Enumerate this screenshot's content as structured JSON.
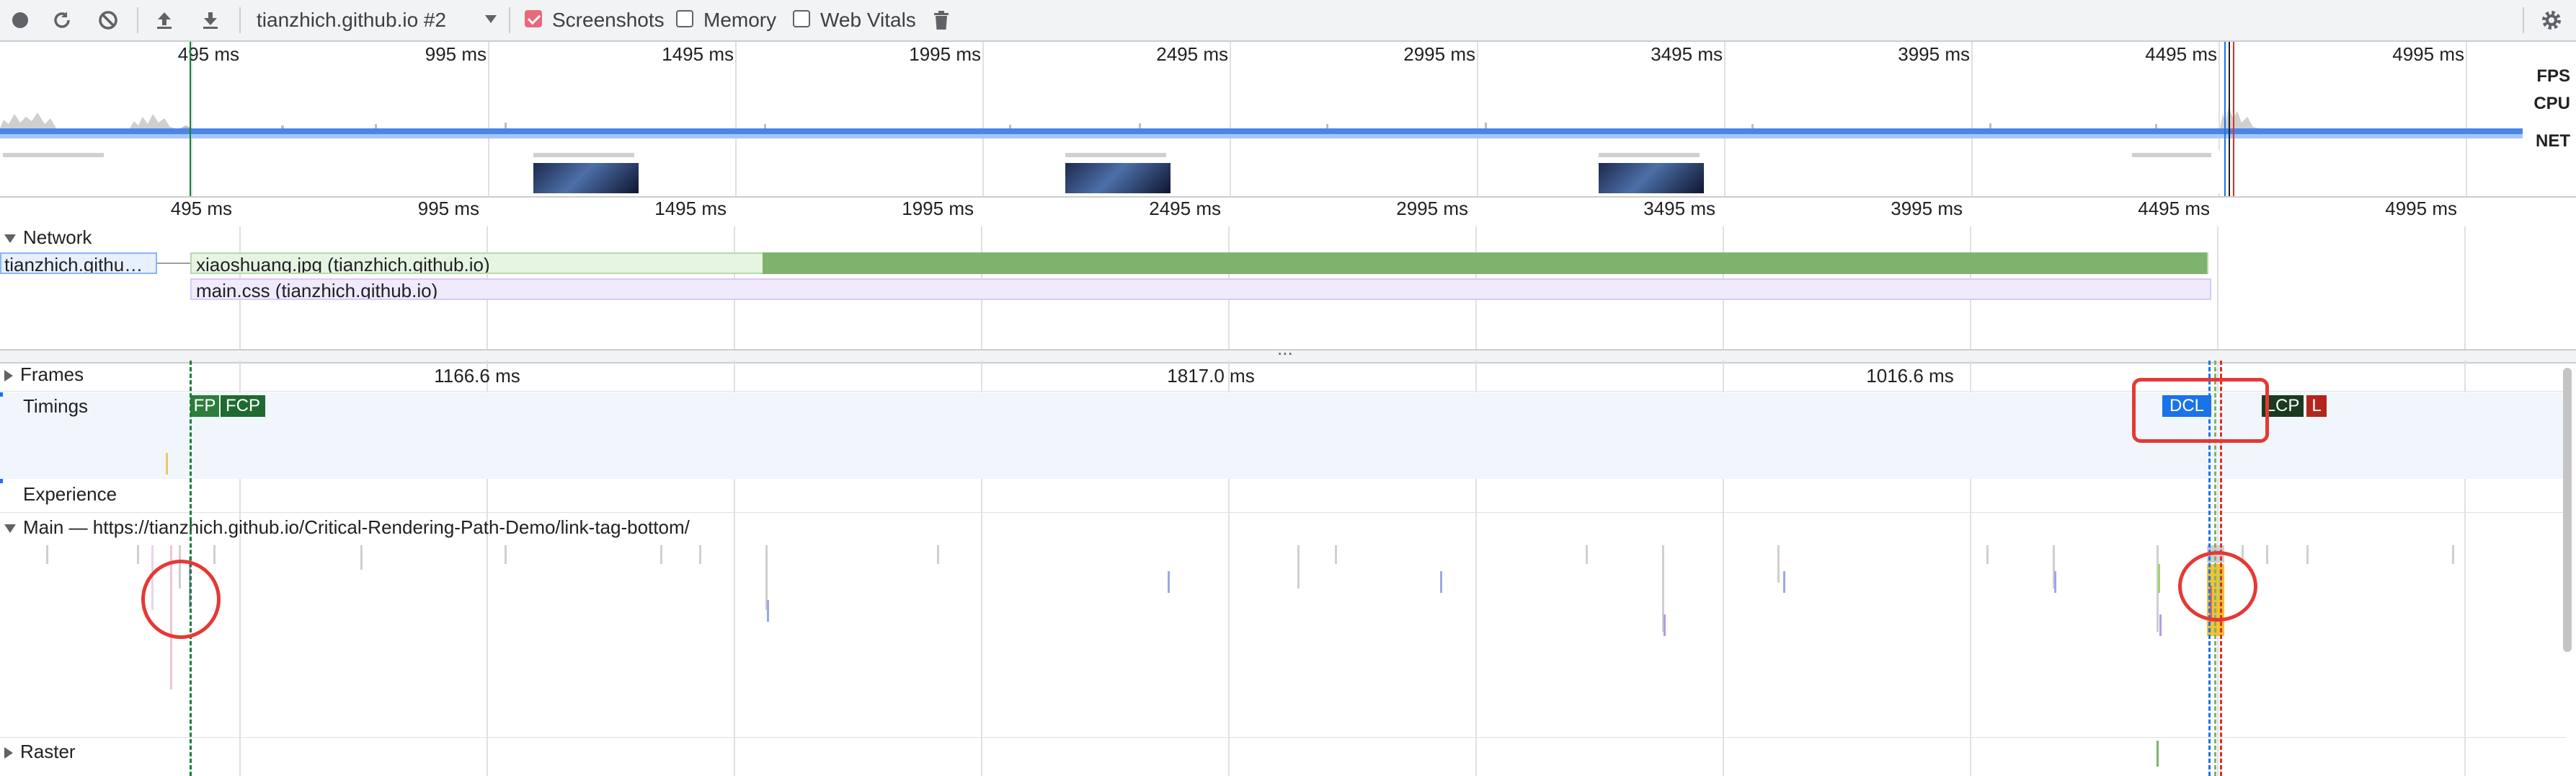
{
  "toolbar": {
    "profile_name": "tianzhich.github.io #2",
    "screenshots_label": "Screenshots",
    "screenshots_checked": true,
    "memory_label": "Memory",
    "memory_checked": false,
    "web_vitals_label": "Web Vitals",
    "web_vitals_checked": false
  },
  "overview": {
    "ticks": [
      "495 ms",
      "995 ms",
      "1495 ms",
      "1995 ms",
      "2495 ms",
      "2995 ms",
      "3495 ms",
      "3995 ms",
      "4495 ms",
      "4995 ms"
    ],
    "fps_label": "FPS",
    "cpu_label": "CPU",
    "net_label": "NET"
  },
  "main_ruler": {
    "ticks": [
      "495 ms",
      "995 ms",
      "1495 ms",
      "1995 ms",
      "2495 ms",
      "2995 ms",
      "3495 ms",
      "3995 ms",
      "4495 ms",
      "4995 ms"
    ]
  },
  "network": {
    "title": "Network",
    "requests": [
      {
        "label": "tianzhich.githu…"
      },
      {
        "label": "xiaoshuang.jpg (tianzhich.github.io)"
      },
      {
        "label": "main.css (tianzhich.github.io)"
      }
    ]
  },
  "splitter_label": "...",
  "tracks": {
    "frames": {
      "title": "Frames",
      "durations": [
        "1166.6 ms",
        "1817.0 ms",
        "1016.6 ms"
      ]
    },
    "timings": {
      "title": "Timings",
      "markers": [
        {
          "label": "FP",
          "color": "#2d7d3c"
        },
        {
          "label": "FCP",
          "color": "#1e6a32"
        },
        {
          "label": "DCL",
          "color": "#1a73e8"
        },
        {
          "label": "LCP",
          "color": "#1b3a22"
        },
        {
          "label": "L",
          "color": "#b3261e"
        }
      ]
    },
    "experience": {
      "title": "Experience"
    },
    "main": {
      "title": "Main — https://tianzhich.github.io/Critical-Rendering-Path-Demo/link-tag-bottom/"
    },
    "raster": {
      "title": "Raster"
    }
  },
  "colors": {
    "annotation_red": "#e53935",
    "image_request": "#7fb26c",
    "css_request": "#d9c9f5",
    "net_bar": "#8ab4f8"
  }
}
